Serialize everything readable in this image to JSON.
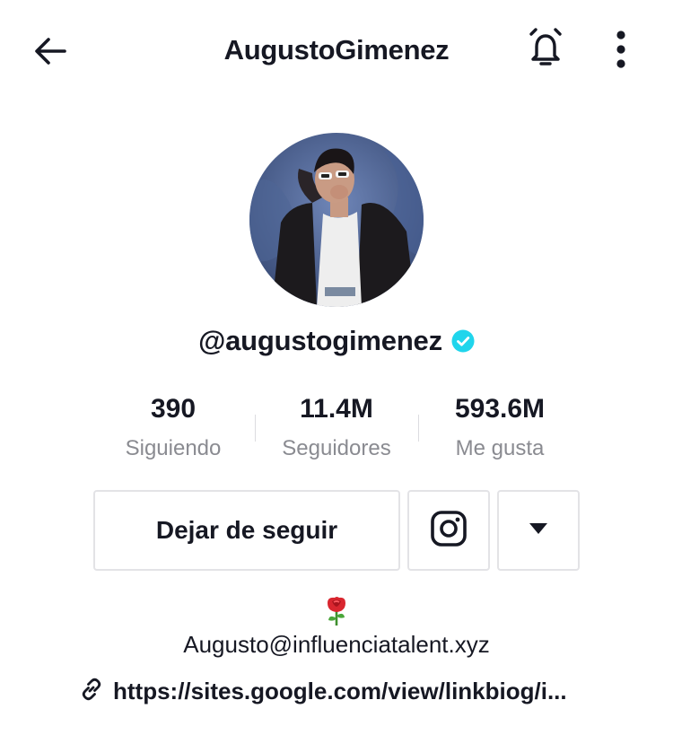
{
  "header": {
    "title": "AugustoGimenez",
    "back_icon": "arrow-left-icon",
    "bell_icon": "bell-icon",
    "more_icon": "more-vertical-icon"
  },
  "profile": {
    "avatar": "profile-photo",
    "username": "@augustogimenez",
    "verified": true,
    "verified_color": "#20d5ec"
  },
  "stats": [
    {
      "value": "390",
      "label": "Siguiendo"
    },
    {
      "value": "11.4M",
      "label": "Seguidores"
    },
    {
      "value": "593.6M",
      "label": "Me gusta"
    }
  ],
  "actions": {
    "unfollow_label": "Dejar de seguir",
    "instagram_icon": "instagram-icon",
    "dropdown_icon": "caret-down-icon"
  },
  "bio": {
    "emoji": "🌹",
    "email": "Augusto@influenciatalent.xyz",
    "link_icon": "link-icon",
    "link": "https://sites.google.com/view/linkbiog/i..."
  },
  "colors": {
    "text": "#161823",
    "muted": "#8a8b91",
    "border": "#e3e3e6"
  }
}
